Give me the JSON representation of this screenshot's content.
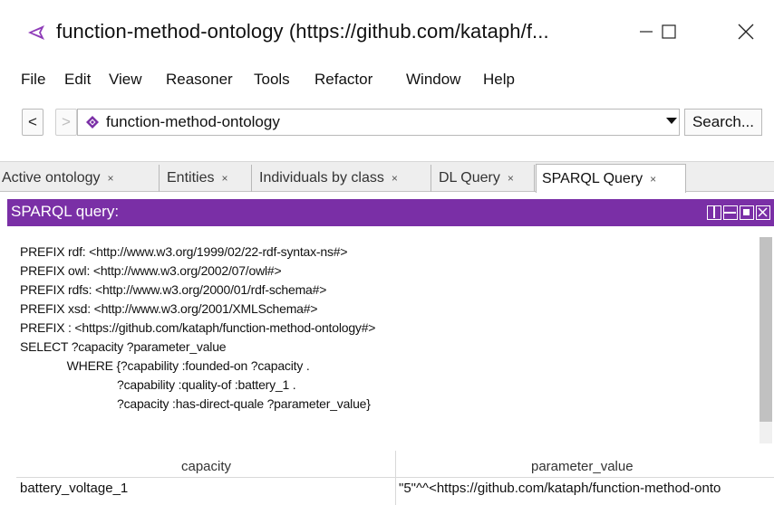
{
  "window": {
    "title": "function-method-ontology (https://github.com/kataph/f..."
  },
  "menu": {
    "items": [
      "File",
      "Edit",
      "View",
      "Reasoner",
      "Tools",
      "Refactor",
      "Window",
      "Help"
    ]
  },
  "nav": {
    "back_label": "<",
    "forward_label": ">",
    "ontology": "function-method-ontology",
    "search_label": "Search..."
  },
  "tabs": [
    {
      "label": "Active ontology",
      "close": "×"
    },
    {
      "label": "Entities",
      "close": "×"
    },
    {
      "label": "Individuals by class",
      "close": "×"
    },
    {
      "label": "DL Query",
      "close": "×"
    },
    {
      "label": "SPARQL Query",
      "close": "×",
      "active": true
    }
  ],
  "view": {
    "title": "SPARQL query:"
  },
  "query": {
    "lines": [
      "PREFIX rdf: <http://www.w3.org/1999/02/22-rdf-syntax-ns#>",
      "PREFIX owl: <http://www.w3.org/2002/07/owl#>",
      "PREFIX rdfs: <http://www.w3.org/2000/01/rdf-schema#>",
      "PREFIX xsd: <http://www.w3.org/2001/XMLSchema#>",
      "PREFIX : <https://github.com/kataph/function-method-ontology#>",
      "SELECT ?capacity ?parameter_value",
      "              WHERE {?capability :founded-on ?capacity .",
      "                             ?capability :quality-of :battery_1 .",
      "                             ?capacity :has-direct-quale ?parameter_value}"
    ]
  },
  "results": {
    "columns": [
      "capacity",
      "parameter_value"
    ],
    "rows": [
      [
        "battery_voltage_1",
        "\"5\"^^<https://github.com/kataph/function-method-onto"
      ]
    ]
  },
  "colors": {
    "view_header": "#7a2fa6",
    "app_icon": "#8e3bb8",
    "ontology_icon": "#7a2fa6"
  },
  "icons": {
    "app": "protege-icon",
    "ontology": "ontology-diamond-icon",
    "minimize": "minimize-icon",
    "maximize": "maximize-icon",
    "close": "close-icon"
  }
}
